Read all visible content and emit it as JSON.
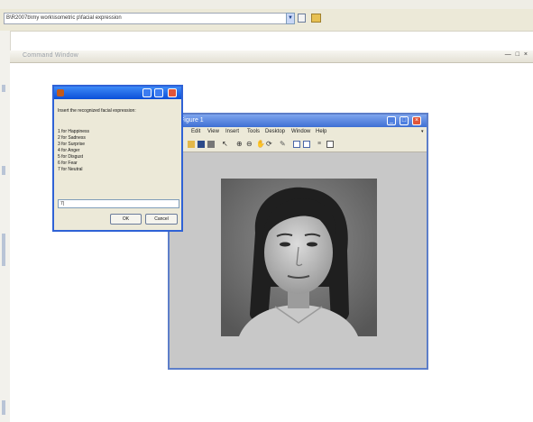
{
  "main_window": {
    "path": "B\\R2007b\\my work\\isometric p\\facial expression",
    "command_window_title": "Command Window",
    "window_controls": [
      "—",
      "□",
      "×"
    ]
  },
  "figure": {
    "title": "Figure 1",
    "menu": [
      "Edit",
      "View",
      "Insert",
      "Tools",
      "Desktop",
      "Window",
      "Help"
    ],
    "toolbar_icons": [
      "open-file-icon",
      "save-icon",
      "print-icon",
      "pointer-icon",
      "zoom-in-icon",
      "zoom-out-icon",
      "pan-icon",
      "rotate-icon",
      "data-cursor-icon",
      "colorbar-icon",
      "legend-icon",
      "hide-plot-tools-icon",
      "show-plot-tools-icon"
    ],
    "image_subject": "grayscale face photo"
  },
  "dialog": {
    "prompt": "Insert the recognized facial expression:",
    "options": [
      "1 for Happiness",
      "2 for Sadness",
      "3 for Surprise",
      "4 for Anger",
      "5 for Disgust",
      "6 for Fear",
      "7 for Neutral"
    ],
    "input_value": "7|",
    "ok_label": "OK",
    "cancel_label": "Cancel"
  },
  "colors": {
    "xp_title_blue": "#0b4fd8",
    "figure_title_blue": "#5d7ec9",
    "close_red": "#e0553a",
    "chrome": "#ece9d8"
  }
}
